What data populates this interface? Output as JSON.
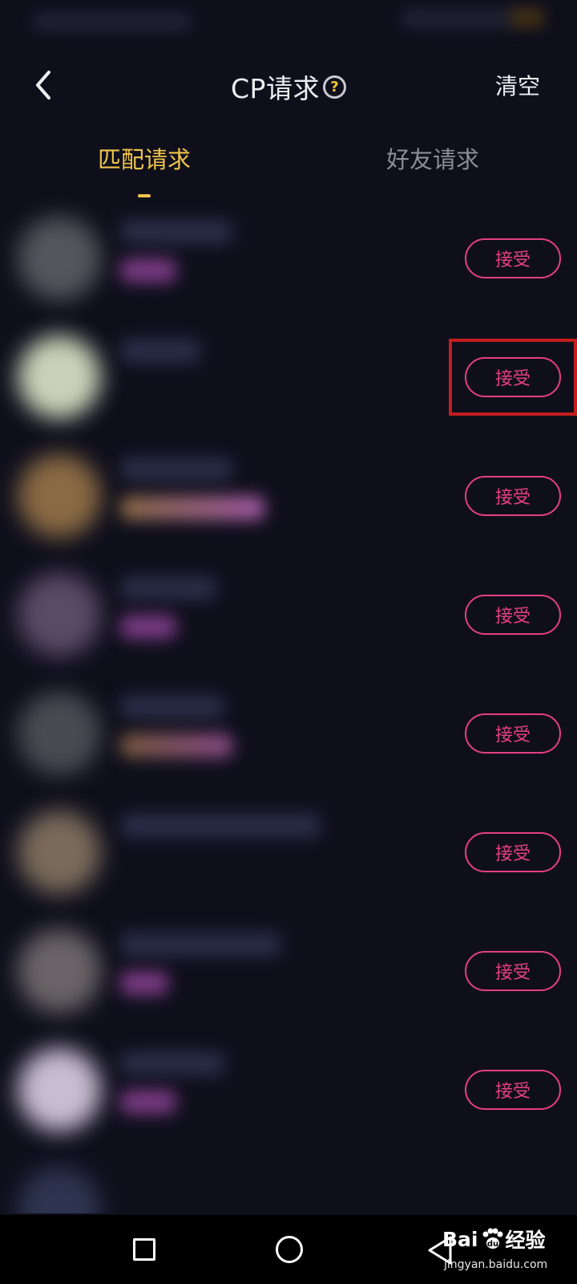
{
  "header": {
    "title": "CP请求",
    "help_symbol": "?",
    "clear_label": "清空"
  },
  "tabs": [
    {
      "label": "匹配请求",
      "active": true
    },
    {
      "label": "好友请求",
      "active": false
    }
  ],
  "requests": [
    {
      "accept_label": "接受"
    },
    {
      "accept_label": "接受",
      "highlighted": true
    },
    {
      "accept_label": "接受"
    },
    {
      "accept_label": "接受"
    },
    {
      "accept_label": "接受"
    },
    {
      "accept_label": "接受"
    },
    {
      "accept_label": "接受"
    },
    {
      "accept_label": "接受"
    }
  ],
  "watermark": {
    "brand_left": "Bai",
    "brand_right": "经验",
    "url": "jingyan.baidu.com"
  },
  "colors": {
    "background": "#0f0f1c",
    "tab_active": "#f0c44a",
    "tab_inactive": "#8c8c99",
    "accept": "#e4407f",
    "highlight": "#c41d1d"
  },
  "icons": {
    "back": "chevron-left-icon",
    "help": "question-circle-icon",
    "nav_recents": "square-icon",
    "nav_home": "circle-icon",
    "nav_back": "triangle-back-icon"
  }
}
